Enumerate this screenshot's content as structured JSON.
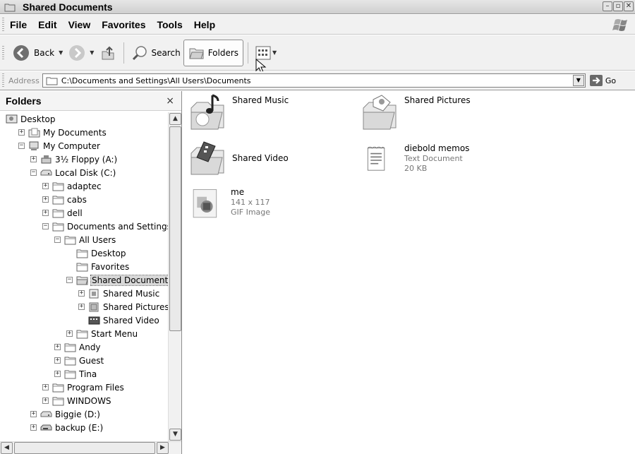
{
  "window": {
    "title": "Shared Documents"
  },
  "menu": [
    "File",
    "Edit",
    "View",
    "Favorites",
    "Tools",
    "Help"
  ],
  "toolbar": {
    "back_label": "Back",
    "search_label": "Search",
    "folders_label": "Folders"
  },
  "address": {
    "label": "Address",
    "path": "C:\\Documents and Settings\\All Users\\Documents",
    "go_label": "Go"
  },
  "folders_pane": {
    "title": "Folders",
    "close_glyph": "×",
    "tree": [
      {
        "label": "Desktop",
        "depth": 0,
        "expander": "none",
        "icon": "desktop-icon"
      },
      {
        "label": "My Documents",
        "depth": 1,
        "expander": "+",
        "icon": "my-documents-icon"
      },
      {
        "label": "My Computer",
        "depth": 1,
        "expander": "-",
        "icon": "my-computer-icon"
      },
      {
        "label": "3½ Floppy (A:)",
        "depth": 2,
        "expander": "+",
        "icon": "floppy-drive-icon"
      },
      {
        "label": "Local Disk (C:)",
        "depth": 2,
        "expander": "-",
        "icon": "hard-disk-icon"
      },
      {
        "label": "adaptec",
        "depth": 3,
        "expander": "+",
        "icon": "folder-icon"
      },
      {
        "label": "cabs",
        "depth": 3,
        "expander": "+",
        "icon": "folder-icon"
      },
      {
        "label": "dell",
        "depth": 3,
        "expander": "+",
        "icon": "folder-icon"
      },
      {
        "label": "Documents and Settings",
        "depth": 3,
        "expander": "-",
        "icon": "folder-icon"
      },
      {
        "label": "All Users",
        "depth": 4,
        "expander": "-",
        "icon": "folder-icon"
      },
      {
        "label": "Desktop",
        "depth": 5,
        "expander": "none",
        "icon": "folder-icon"
      },
      {
        "label": "Favorites",
        "depth": 5,
        "expander": "none",
        "icon": "folder-icon"
      },
      {
        "label": "Shared Documents",
        "depth": 5,
        "expander": "-",
        "icon": "open-folder-icon",
        "selected": true
      },
      {
        "label": "Shared Music",
        "depth": 6,
        "expander": "+",
        "icon": "shared-music-folder-icon"
      },
      {
        "label": "Shared Pictures",
        "depth": 6,
        "expander": "+",
        "icon": "shared-pictures-folder-icon"
      },
      {
        "label": "Shared Video",
        "depth": 6,
        "expander": "none",
        "icon": "shared-video-folder-icon"
      },
      {
        "label": "Start Menu",
        "depth": 5,
        "expander": "+",
        "icon": "folder-icon"
      },
      {
        "label": "Andy",
        "depth": 4,
        "expander": "+",
        "icon": "folder-icon"
      },
      {
        "label": "Guest",
        "depth": 4,
        "expander": "+",
        "icon": "folder-icon"
      },
      {
        "label": "Tina",
        "depth": 4,
        "expander": "+",
        "icon": "folder-icon"
      },
      {
        "label": "Program Files",
        "depth": 3,
        "expander": "+",
        "icon": "folder-icon"
      },
      {
        "label": "WINDOWS",
        "depth": 3,
        "expander": "+",
        "icon": "folder-icon"
      },
      {
        "label": "Biggie (D:)",
        "depth": 2,
        "expander": "+",
        "icon": "hard-disk-icon"
      },
      {
        "label": "backup (E:)",
        "depth": 2,
        "expander": "+",
        "icon": "removable-drive-icon"
      }
    ]
  },
  "content": {
    "items": [
      {
        "name": "Shared Music",
        "icon": "shared-music-folder-icon"
      },
      {
        "name": "Shared Pictures",
        "icon": "shared-pictures-folder-icon"
      },
      {
        "name": "Shared Video",
        "icon": "shared-video-folder-icon"
      },
      {
        "name": "diebold memos",
        "icon": "text-document-icon",
        "type": "Text Document",
        "size": "20 KB"
      },
      {
        "name": "me",
        "icon": "gif-image-icon",
        "dimensions": "141 x 117",
        "type": "GIF Image"
      }
    ]
  }
}
